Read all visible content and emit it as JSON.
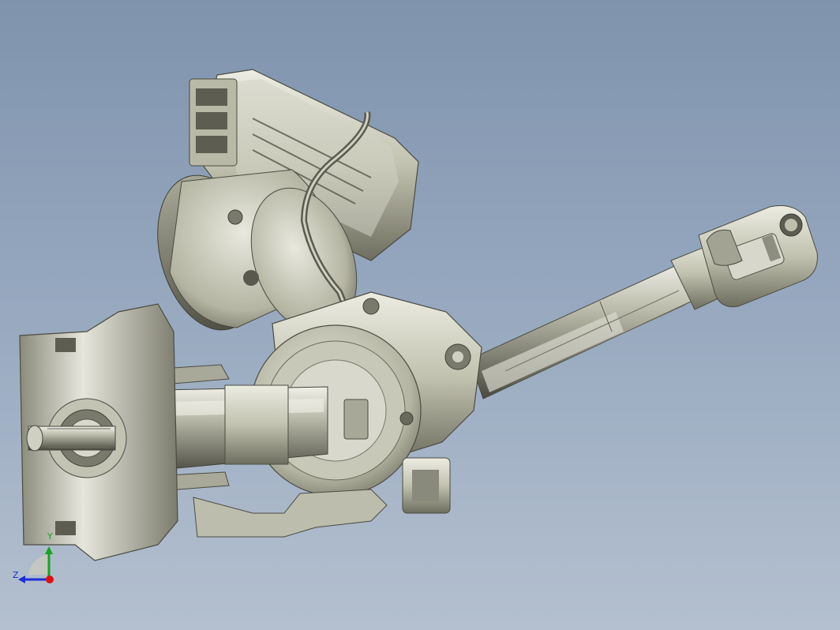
{
  "viewport": {
    "background_top": "#7f93ad",
    "background_bottom": "#b4c0cf"
  },
  "model": {
    "part_color": "#c9c9b8",
    "shadow_color": "#5f5f52",
    "highlight_color": "#ecece2"
  },
  "triad": {
    "z_label": "Z",
    "y_label": "Y",
    "x_color": "#e01010",
    "y_color": "#14a51a",
    "z_color": "#1b2fd6"
  }
}
